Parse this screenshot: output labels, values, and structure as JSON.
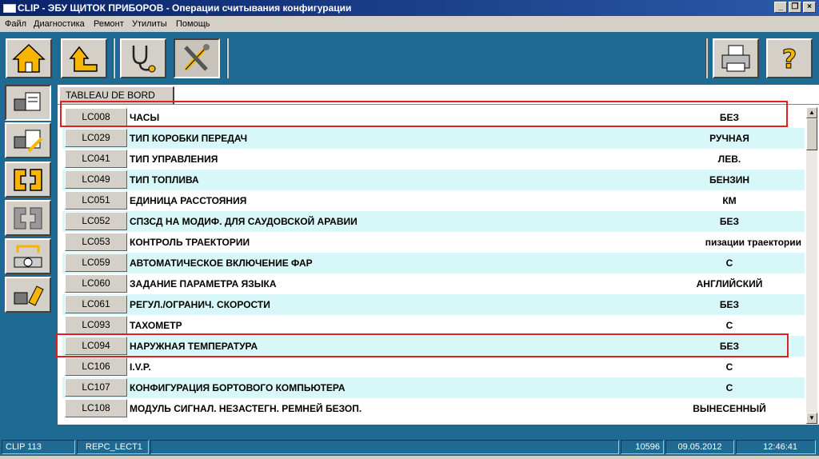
{
  "window": {
    "title": "CLIP - ЭБУ ЩИТОК ПРИБОРОВ - Операции считывания конфигурации"
  },
  "menu": [
    "Файл",
    "Диагностика",
    "Ремонт",
    "Утилиты",
    "Помощь"
  ],
  "toolbar": {
    "icons": [
      "home-icon",
      "back-up-icon",
      "stethoscope-icon",
      "tools-icon",
      "printer-icon",
      "help-icon"
    ]
  },
  "sidebar": {
    "icons": [
      "ecu-read-icon",
      "ecu-write-icon",
      "connector-icon",
      "connector-disabled-icon",
      "exchange-icon",
      "eraser-icon"
    ]
  },
  "tab": {
    "label": "TABLEAU DE BORD"
  },
  "rows": [
    {
      "code": "LC008",
      "label": "ЧАСЫ",
      "value": "БЕЗ"
    },
    {
      "code": "LC029",
      "label": "ТИП КОРОБКИ ПЕРЕДАЧ",
      "value": "РУЧНАЯ"
    },
    {
      "code": "LC041",
      "label": "ТИП УПРАВЛЕНИЯ",
      "value": "ЛЕВ."
    },
    {
      "code": "LC049",
      "label": "ТИП ТОПЛИВА",
      "value": "БЕНЗИН"
    },
    {
      "code": "LC051",
      "label": "ЕДИНИЦА РАССТОЯНИЯ",
      "value": "КМ"
    },
    {
      "code": "LC052",
      "label": "СПЗСД НА МОДИФ. ДЛЯ САУДОВСКОЙ АРАВИИ",
      "value": "БЕЗ"
    },
    {
      "code": "LC053",
      "label": "КОНТРОЛЬ ТРАЕКТОРИИ",
      "value": "пизации траектории"
    },
    {
      "code": "LC059",
      "label": "АВТОМАТИЧЕСКОЕ ВКЛЮЧЕНИЕ ФАР",
      "value": "С"
    },
    {
      "code": "LC060",
      "label": "ЗАДАНИЕ ПАРАМЕТРА ЯЗЫКА",
      "value": "АНГЛИЙСКИЙ"
    },
    {
      "code": "LC061",
      "label": "РЕГУЛ./ОГРАНИЧ. СКОРОСТИ",
      "value": "БЕЗ"
    },
    {
      "code": "LC093",
      "label": "ТАХОМЕТР",
      "value": "С"
    },
    {
      "code": "LC094",
      "label": "НАРУЖНАЯ ТЕМПЕРАТУРА",
      "value": "БЕЗ"
    },
    {
      "code": "LC106",
      "label": "I.V.P.",
      "value": "С"
    },
    {
      "code": "LC107",
      "label": "КОНФИГУРАЦИЯ БОРТОВОГО КОМПЬЮТЕРА",
      "value": "С"
    },
    {
      "code": "LC108",
      "label": "МОДУЛЬ СИГНАЛ. НЕЗАСТЕГН. РЕМНЕЙ БЕЗОП.",
      "value": "ВЫНЕСЕННЫЙ"
    }
  ],
  "status": {
    "app": "CLIP 113",
    "screen": "REPC_LECT1",
    "number": "10596",
    "date": "09.05.2012",
    "time": "12:46:41"
  },
  "colors": {
    "background": "#1e6a92",
    "row_alt": "#d8f7f8",
    "highlight": "#e02020"
  }
}
